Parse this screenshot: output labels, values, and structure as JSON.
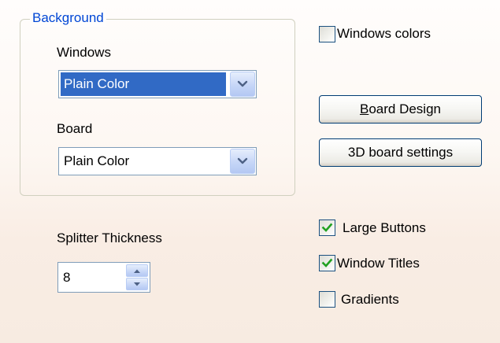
{
  "background_group": {
    "legend": "Background",
    "windows": {
      "label": "Windows",
      "value": "Plain Color"
    },
    "board": {
      "label": "Board",
      "value": "Plain Color"
    }
  },
  "windows_colors": {
    "label": "Windows colors",
    "checked": false
  },
  "buttons": {
    "board_design_accel": "B",
    "board_design_rest": "oard Design",
    "board_3d_settings": "3D board settings"
  },
  "splitter": {
    "label": "Splitter Thickness",
    "value": "8"
  },
  "options": {
    "large_buttons": {
      "label": "Large Buttons",
      "checked": true
    },
    "window_titles": {
      "label": "Window Titles",
      "checked": true
    },
    "gradients": {
      "label": "Gradients",
      "checked": false
    }
  },
  "icons": {
    "dropdown": "chevron-down-icon",
    "spin_up": "spin-up-arrow-icon",
    "spin_down": "spin-down-arrow-icon",
    "check": "checkmark-icon"
  },
  "colors": {
    "legend_text": "#0046d5",
    "selection": "#316ac5",
    "check_green": "#21a121",
    "checkbox_border": "#1c5180",
    "button_border": "#003c74"
  }
}
